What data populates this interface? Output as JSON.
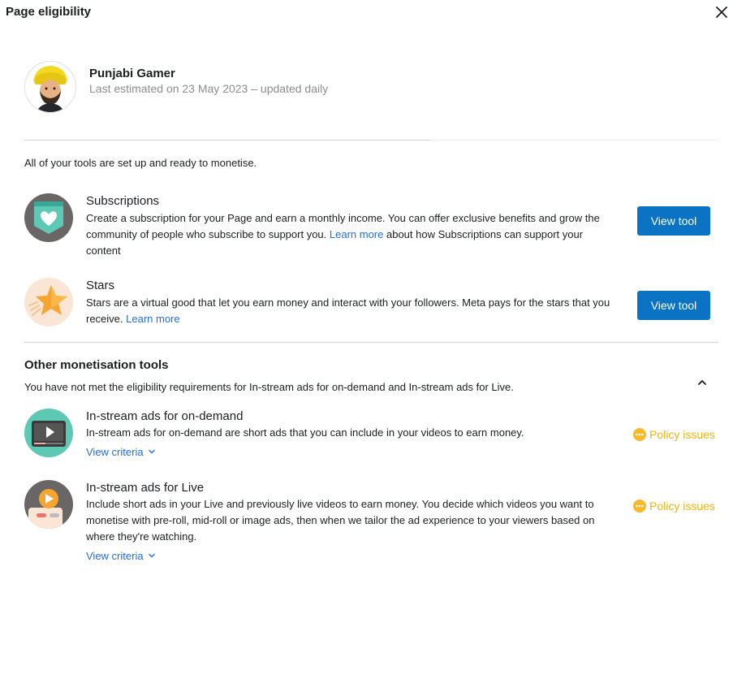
{
  "dialog": {
    "title": "Page eligibility"
  },
  "profile": {
    "name": "Punjabi Gamer",
    "estimate": "Last estimated on 23 May 2023 – updated daily"
  },
  "status_text": "All of your tools are set up and ready to monetise.",
  "tools": {
    "subscriptions": {
      "name": "Subscriptions",
      "desc_a": "Create a subscription for your Page and earn a monthly income. You can offer exclusive benefits and grow the community of people who subscribe to support you. ",
      "link": "Learn more",
      "desc_b": " about how Subscriptions can support your content",
      "button": "View tool"
    },
    "stars": {
      "name": "Stars",
      "desc_a": "Stars are a virtual good that let you earn money and interact with your followers. Meta pays for the stars that you receive. ",
      "link": "Learn more",
      "button": "View tool"
    }
  },
  "other": {
    "heading": "Other monetisation tools",
    "note": "You have not met the eligibility requirements for In-stream ads for on-demand and In-stream ads for Live.",
    "on_demand": {
      "name": "In-stream ads for on-demand",
      "desc": "In-stream ads for on-demand are short ads that you can include in your videos to earn money.",
      "criteria": "View criteria",
      "status": "Policy issues"
    },
    "live": {
      "name": "In-stream ads for Live",
      "desc": "Include short ads in your Live and previously live videos to earn money. You decide which videos you want to monetise with pre-roll, mid-roll or image ads, then when we tailor the ad experience to your viewers based on where they're watching.",
      "criteria": "View criteria",
      "status": "Policy issues"
    }
  },
  "icons": {
    "close": "close-icon",
    "collapse": "chevron-up-icon",
    "criteria": "chevron-down-icon",
    "status": "more-dots-icon"
  },
  "colors": {
    "primary_button": "#0a73c4",
    "link": "#216fdb",
    "warning": "#f2b30b",
    "subscriptions_icon_bg": "#6b6666",
    "stars_icon_bg": "#fbe6d6",
    "on_demand_icon_bg": "#5dc8b3",
    "live_icon_bg": "#6b6666"
  }
}
